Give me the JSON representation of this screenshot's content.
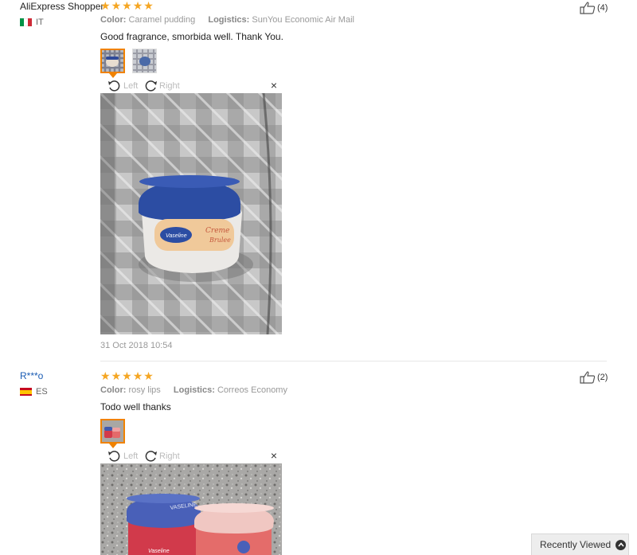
{
  "reviews": [
    {
      "author": "AliExpress Shopper",
      "country": "IT",
      "color_label": "Color:",
      "color_value": "Caramel pudding",
      "logistics_label": "Logistics:",
      "logistics_value": "SunYou Economic Air Mail",
      "text": "Good fragrance, smorbida well. Thank You.",
      "date": "31 Oct 2018 10:54",
      "helpful": "(4)",
      "rating": 5,
      "images": [
        "review-photo-1",
        "review-photo-2"
      ]
    },
    {
      "author": "R***o",
      "country": "ES",
      "color_label": "Color:",
      "color_value": "rosy lips",
      "logistics_label": "Logistics:",
      "logistics_value": "Correos Economy",
      "text": "Todo well thanks",
      "helpful": "(2)",
      "rating": 5,
      "images": [
        "review-photo-1"
      ]
    }
  ],
  "viewer": {
    "left_label": "Left",
    "right_label": "Right",
    "close": "×"
  },
  "recently_viewed": "Recently Viewed",
  "icons": {
    "star": "star-icon",
    "thumbs_up": "thumbs-up-icon",
    "rotate_left": "rotate-left-icon",
    "rotate_right": "rotate-right-icon",
    "close": "close-icon",
    "chevron_up": "chevron-up-icon"
  },
  "colors": {
    "star": "#f5a623",
    "active_thumb": "#f08200",
    "link": "#1a5bb3"
  }
}
